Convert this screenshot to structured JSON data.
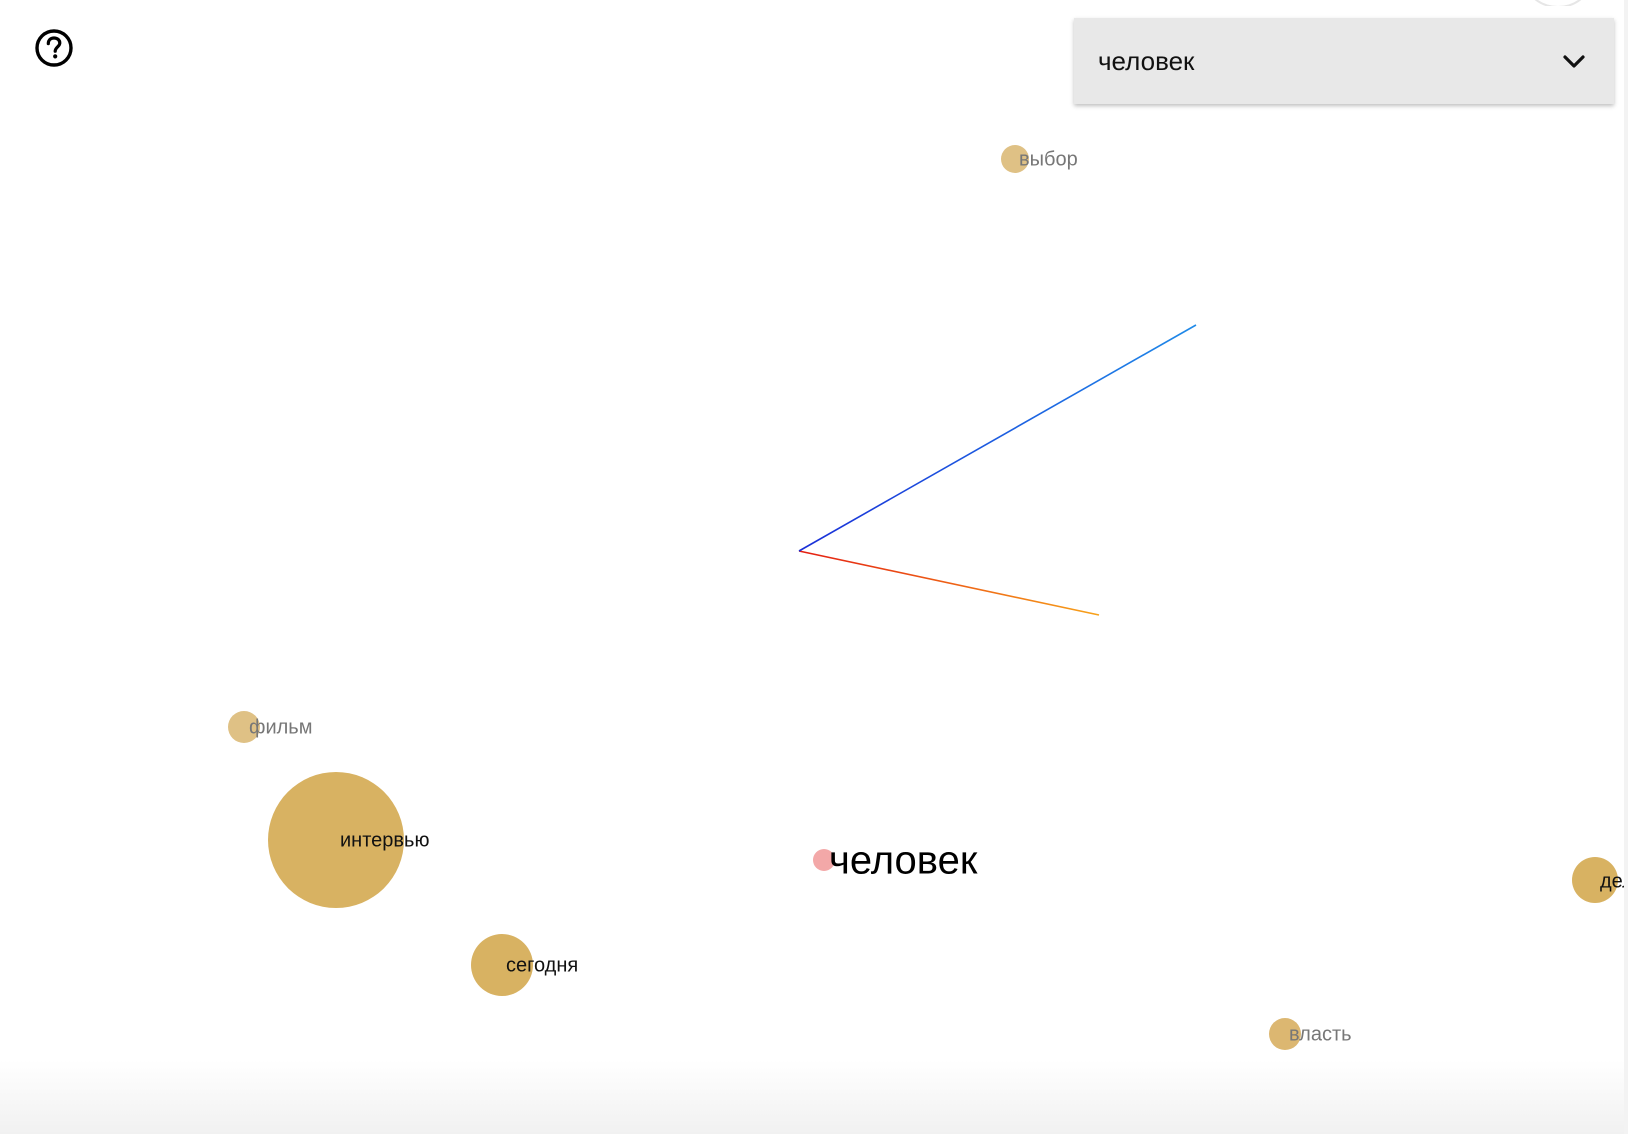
{
  "selector": {
    "value": "человек"
  },
  "axes": {
    "x_color": "#e82a1a",
    "y_color": "#7ad21a",
    "z_color": "#1f5ee8"
  },
  "words": [
    {
      "label": "человек",
      "role": "query",
      "color": "#f3a8a8"
    },
    {
      "label": "выбор",
      "role": "far",
      "color": "#dfc185"
    },
    {
      "label": "фильм",
      "role": "far",
      "color": "#dfc185"
    },
    {
      "label": "интервью",
      "role": "near",
      "color": "#d8b262"
    },
    {
      "label": "сегодня",
      "role": "near",
      "color": "#d8b262"
    },
    {
      "label": "власть",
      "role": "far",
      "color": "#dcb771"
    },
    {
      "label": "дел",
      "role": "near",
      "color": "#d8b262"
    }
  ],
  "icons": {
    "help": "help-circle-icon",
    "dropdown": "chevron-down-icon"
  }
}
